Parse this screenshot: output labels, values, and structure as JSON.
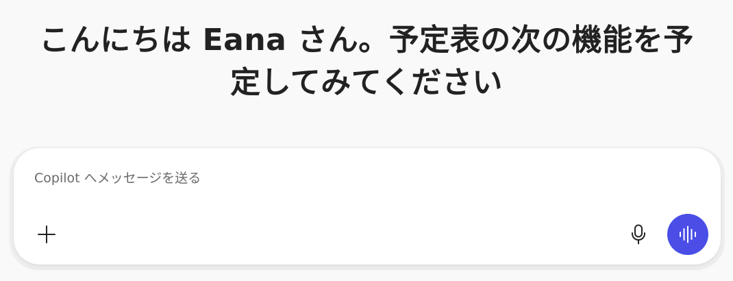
{
  "greeting": {
    "line1": "こんにちは Eana さん。予定表の次の機能を予",
    "line2": "定してみてください"
  },
  "composer": {
    "placeholder": "Copilot へメッセージを送る",
    "value": ""
  },
  "icons": {
    "add": "plus-icon",
    "mic": "microphone-icon",
    "voice": "voice-waveform-icon"
  },
  "colors": {
    "background": "#f9f9f9",
    "accent": "#4a4ee6",
    "title_text": "#222222",
    "placeholder_text": "#6a6a6a"
  }
}
